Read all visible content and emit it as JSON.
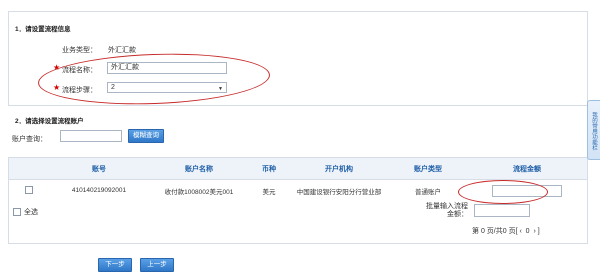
{
  "section1": {
    "title": "1．请设置流程信息",
    "business_type_label": "业务类型：",
    "business_type_value": "外汇汇款",
    "flow_name_label": "流程名称：",
    "flow_name_value": "外汇汇款",
    "flow_steps_label": "流程步骤：",
    "flow_steps_value": "2",
    "required_mark": "★"
  },
  "section2": {
    "title": "2．请选择设置流程账户",
    "account_query_label": "账户查询：",
    "account_query_value": "",
    "search_button": "模糊查询"
  },
  "table": {
    "columns": [
      "账号",
      "账户名称",
      "币种",
      "开户机构",
      "账户类型",
      "流程金额"
    ],
    "rows": [
      {
        "account": "410140219092001",
        "name": "收付款1008002美元001",
        "currency": "美元",
        "bank": "中国建设银行安阳分行营业部",
        "type": "普通账户",
        "amount": ""
      }
    ],
    "select_all": "全选",
    "batch_label_line1": "批量输入流程",
    "batch_label_line2": "金额：",
    "pagination": "第 0 页/共0 页[ ‹  0  › ]"
  },
  "buttons": {
    "next": "下一步",
    "prev": "上一步"
  },
  "side_tab": "我的常用功能栏",
  "colors": {
    "accent": "#2f78c8",
    "header_text": "#1f5fa8",
    "annotation": "#c72a2a"
  }
}
